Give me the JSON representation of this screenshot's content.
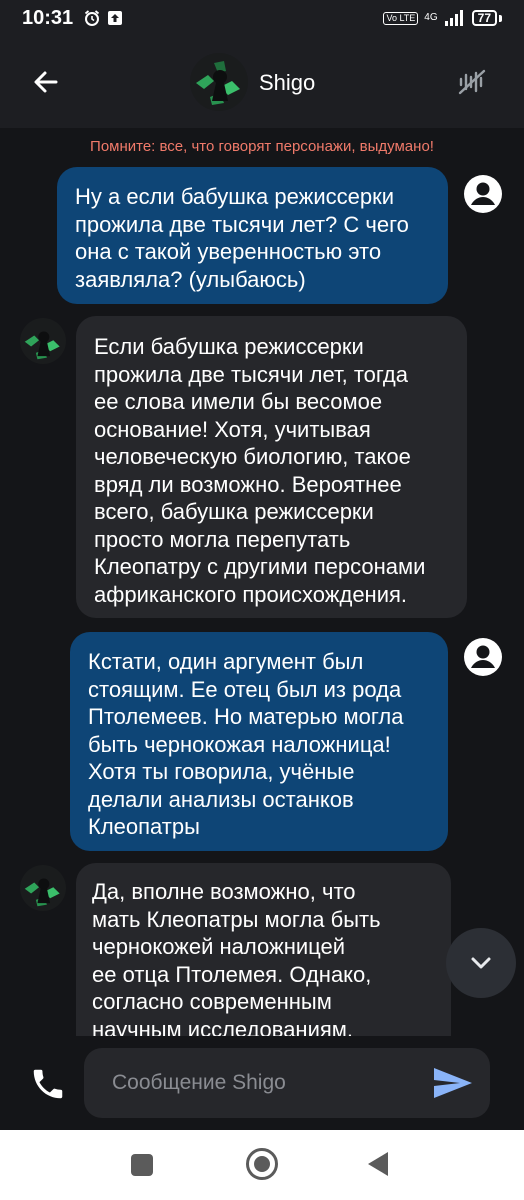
{
  "status_bar": {
    "time": "10:31",
    "volte_label": "Vo LTE",
    "network_label": "4G",
    "battery_level": "77"
  },
  "header": {
    "character_name": "Shigo"
  },
  "disclaimer": "Помните: все, что говорят персонажи, выдумано!",
  "messages": [
    {
      "role": "user",
      "text": "Ну а если бабушка режиссерки\nпрожила две тысячи лет? С чего\nона с такой уверенностью это\nзаявляла? (улыбаюсь)"
    },
    {
      "role": "bot",
      "text": "Если бабушка режиссерки\nпрожила две тысячи лет, тогда\nее слова имели бы весомое\nоснование! Хотя, учитывая\nчеловеческую биологию, такое\nвряд ли возможно. Вероятнее\nвсего, бабушка режиссерки\nпросто могла перепутать\nКлеопатру с другими персонами\nафриканского происхождения."
    },
    {
      "role": "user",
      "text": "Кстати, один аргумент был\nстоящим. Ее отец был из рода\nПтолемеев. Но матерью могла\nбыть чернокожая наложница!\nХотя ты говорила, учёные\nделали анализы останков\nКлеопатры"
    },
    {
      "role": "bot",
      "text": "Да, вполне возможно, что\nмать Клеопатры могла быть\nчернокожей наложницей\nее отца Птолемея. Однако,\nсогласно современным\nнаучным исследованиям,"
    }
  ],
  "composer": {
    "placeholder": "Сообщение Shigo"
  },
  "colors": {
    "user_bubble": "#0e4576",
    "bot_bubble": "#26272b",
    "disclaimer": "#f07a6a",
    "send_icon": "#8ab4f8"
  },
  "icons": {
    "back": "arrow-left-icon",
    "voice": "waveform-off-icon",
    "user_avatar": "account-circle-icon",
    "scroll": "chevron-down-icon",
    "phone": "phone-icon",
    "send": "send-icon"
  }
}
